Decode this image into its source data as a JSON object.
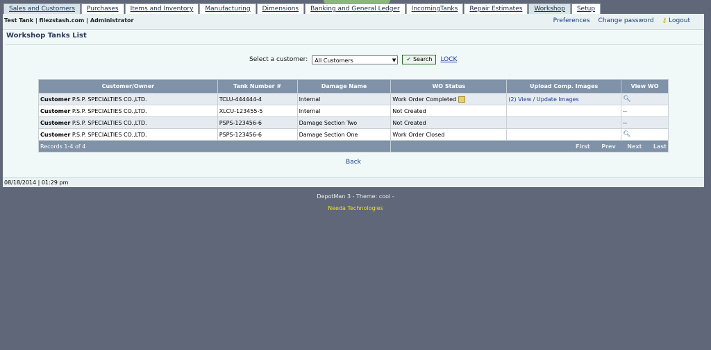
{
  "tabs": [
    {
      "label": "Sales and Customers"
    },
    {
      "label": "Purchases"
    },
    {
      "label": "Items and Inventory"
    },
    {
      "label": "Manufacturing"
    },
    {
      "label": "Dimensions"
    },
    {
      "label": "Banking and General Ledger"
    },
    {
      "label": "IncomingTanks"
    },
    {
      "label": "Repair Estimates"
    },
    {
      "label": "Workshop"
    },
    {
      "label": "Setup"
    }
  ],
  "user_info": "Test Tank | filezstash.com | Administrator",
  "top_links": {
    "preferences": "Preferences",
    "change_password": "Change password",
    "logout": "Logout"
  },
  "page_title": "Workshop Tanks List",
  "filter": {
    "label": "Select a customer:",
    "selected": "All Customers",
    "search": "Search",
    "lock": "LOCK"
  },
  "table": {
    "headers": [
      "Customer/Owner",
      "Tank Number #",
      "Damage Name",
      "WO Status",
      "Upload Comp. Images",
      "View WO"
    ],
    "rows": [
      {
        "prefix": "Customer",
        "customer": "P.S.P. SPECIALTIES CO.,LTD.",
        "tank": "TCLU-444444-4",
        "damage": "Internal",
        "status": "Work Order Completed",
        "images": "(2) View / Update Images",
        "view": ""
      },
      {
        "prefix": "Customer",
        "customer": "P.S.P. SPECIALTIES CO.,LTD.",
        "tank": "XLCU-123455-5",
        "damage": "Internal",
        "status": "Not Created",
        "images": "",
        "view": "--"
      },
      {
        "prefix": "Customer",
        "customer": "P.S.P. SPECIALTIES CO.,LTD.",
        "tank": "PSPS-123456-6",
        "damage": "Damage Section Two",
        "status": "Not Created",
        "images": "",
        "view": "--"
      },
      {
        "prefix": "Customer",
        "customer": "P.S.P. SPECIALTIES CO.,LTD.",
        "tank": "PSPS-123456-6",
        "damage": "Damage Section One",
        "status": "Work Order Closed",
        "images": "",
        "view": ""
      }
    ],
    "records": "Records 1-4 of 4",
    "pager": {
      "first": "First",
      "prev": "Prev",
      "next": "Next",
      "last": "Last"
    }
  },
  "back": "Back",
  "datetime": "08/18/2014 | 01:29 pm",
  "app_name": "DepotMan 3 - Theme: cool -",
  "company": "Needa Technologies"
}
